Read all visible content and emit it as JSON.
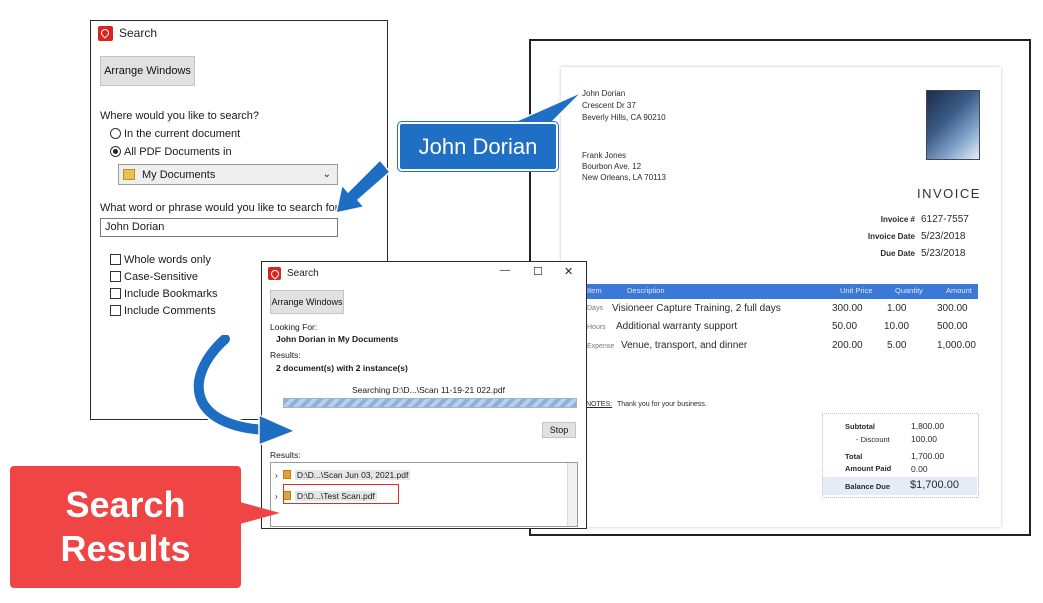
{
  "search_dialog": {
    "title": "Search",
    "arrange_windows_label": "Arrange Windows",
    "where_prompt": "Where would you like to search?",
    "option_current": "In the current document",
    "option_all": "All PDF Documents in",
    "location_value": "My Documents",
    "phrase_prompt": "What word or phrase would you like to search for?",
    "phrase_value": "John Dorian",
    "opt_whole_words": "Whole words only",
    "opt_case_sensitive": "Case-Sensitive",
    "opt_bookmarks": "Include Bookmarks",
    "opt_comments": "Include Comments"
  },
  "results_dialog": {
    "title": "Search",
    "minimize": "—",
    "maximize": "☐",
    "close": "✕",
    "arrange_windows_label": "Arrange Windows",
    "looking_for_label": "Looking For:",
    "looking_for_value": "John Dorian in My Documents",
    "results_label": "Results:",
    "results_summary": "2 document(s) with 2 instance(s)",
    "searching_status": "Searching D:\\D...\\Scan 11-19-21 022.pdf",
    "progress": 1.0,
    "stop_label": "Stop",
    "results_list_label": "Results:",
    "results_items": [
      "D:\\D...\\Scan Jun 03, 2021.pdf",
      "D:\\D...\\Test Scan.pdf"
    ]
  },
  "callouts": {
    "john_dorian": "John Dorian",
    "search_results_line1": "Search",
    "search_results_line2": "Results"
  },
  "invoice": {
    "sender_lines": [
      "John Dorian",
      "Crescent Dr 37",
      "Beverly Hills,  CA  90210"
    ],
    "recipient_lines": [
      "Frank Jones",
      "Bourbon Ave. 12",
      "New Orleans,  LA  70113"
    ],
    "title": "INVOICE",
    "meta": [
      {
        "label": "Invoice #",
        "value": "6127-7557"
      },
      {
        "label": "Invoice Date",
        "value": "5/23/2018"
      },
      {
        "label": "Due Date",
        "value": "5/23/2018"
      }
    ],
    "columns": [
      "Item",
      "Description",
      "Unit Price",
      "Quantity",
      "Amount"
    ],
    "rows": [
      {
        "item": "Days",
        "desc": "Visioneer Capture Training, 2 full days",
        "price": "300.00",
        "qty": "1.00",
        "amount": "300.00"
      },
      {
        "item": "Hours",
        "desc": "Additional warranty support",
        "price": "50.00",
        "qty": "10.00",
        "amount": "500.00"
      },
      {
        "item": "Expense",
        "desc": "Venue, transport, and dinner",
        "price": "200.00",
        "qty": "5.00",
        "amount": "1,000.00"
      }
    ],
    "notes_label": "NOTES:",
    "notes_text": "Thank you for your business.",
    "totals": [
      {
        "label": "Subtotal",
        "value": "1,800.00"
      },
      {
        "label": "- Discount",
        "value": "100.00"
      },
      {
        "label": "Total",
        "value": "1,700.00"
      },
      {
        "label": "Amount Paid",
        "value": "0.00"
      }
    ],
    "balance_label": "Balance Due",
    "balance_value": "$1,700.00"
  },
  "colors": {
    "callout_blue": "#1f6fc4",
    "callout_red": "#f04545",
    "arrow_blue": "#1d6dc3",
    "table_header": "#3c78d8"
  }
}
